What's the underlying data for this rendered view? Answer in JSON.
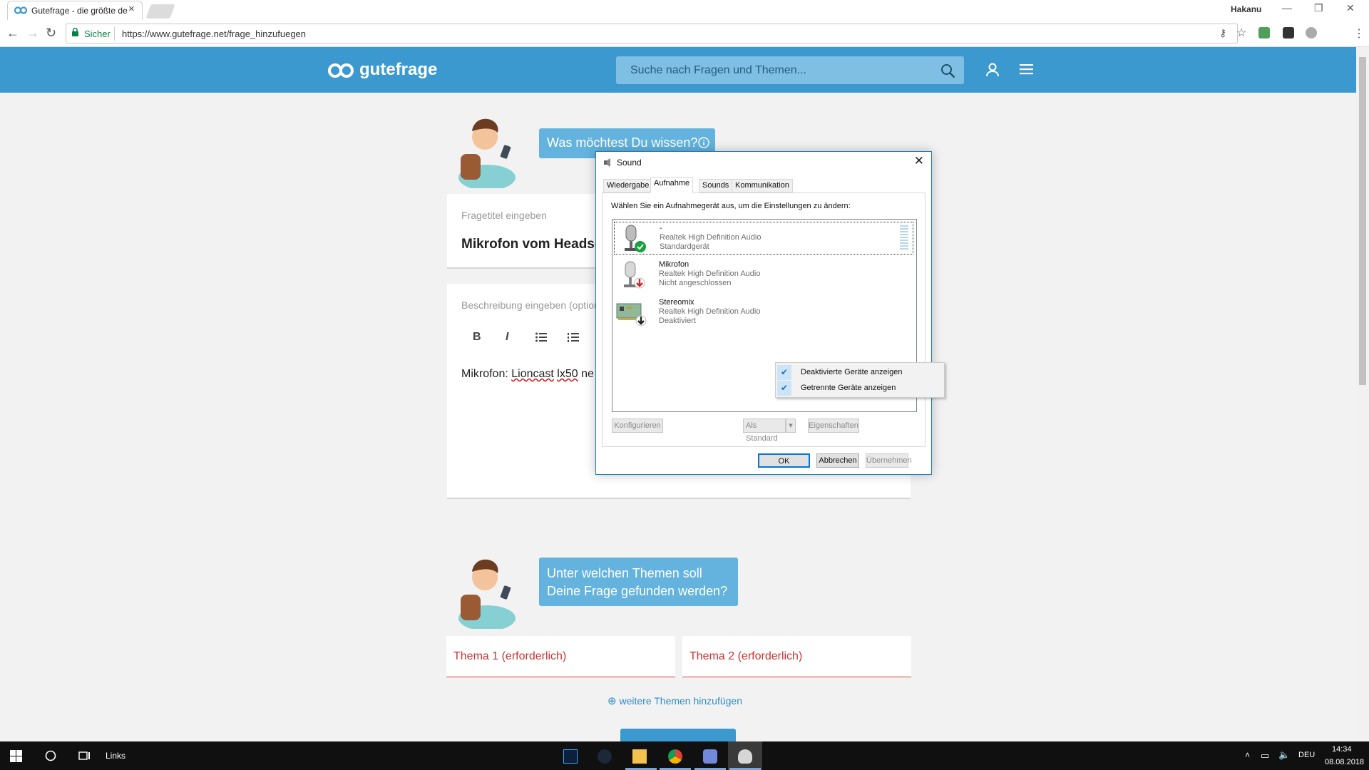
{
  "browser": {
    "tab_title": "Gutefrage - die größte de",
    "tab_close": "×",
    "user": "Hakanu",
    "secure_label": "Sicher",
    "url": "https://www.gutefrage.net/frage_hinzufuegen"
  },
  "site": {
    "logo": "gutefrage",
    "search_placeholder": "Suche nach Fragen und Themen..."
  },
  "question": {
    "bubble": "Was möchtest Du wissen?",
    "title_label": "Fragetitel eingeben",
    "title_value": "Mikrofon vom Headse",
    "desc_label": "Beschreibung eingeben (option",
    "toolbar": {
      "bold": "B",
      "italic": "I"
    },
    "desc_text_prefix": "Mikrofon: ",
    "desc_text_word1": "Lioncast",
    "desc_text_word2": "lx50",
    "desc_text_suffix": " ne"
  },
  "topics": {
    "bubble_line1": "Unter welchen Themen soll",
    "bubble_line2": "Deine Frage gefunden werden?",
    "topic1": "Thema 1 (erforderlich)",
    "topic2": "Thema 2 (erforderlich)",
    "add_more": "weitere Themen hinzufügen"
  },
  "dialog": {
    "title": "Sound",
    "tabs": [
      "Wiedergabe",
      "Aufnahme",
      "Sounds",
      "Kommunikation"
    ],
    "instruction": "Wählen Sie ein Aufnahmegerät aus, um die Einstellungen zu ändern:",
    "devices": [
      {
        "name": "-",
        "driver": "Realtek High Definition Audio",
        "status": "Standardgerät"
      },
      {
        "name": "Mikrofon",
        "driver": "Realtek High Definition Audio",
        "status": "Nicht angeschlossen"
      },
      {
        "name": "Stereomix",
        "driver": "Realtek High Definition Audio",
        "status": "Deaktiviert"
      }
    ],
    "context_menu": [
      "Deaktivierte Geräte anzeigen",
      "Getrennte Geräte anzeigen"
    ],
    "buttons": {
      "configure": "Konfigurieren",
      "set_default": "Als Standard",
      "properties": "Eigenschaften",
      "ok": "OK",
      "cancel": "Abbrechen",
      "apply": "Übernehmen"
    }
  },
  "taskbar": {
    "links": "Links",
    "lang": "DEU",
    "time": "14:34",
    "date": "08.08.2018"
  },
  "colors": {
    "brand": "#3c99cf",
    "bubble": "#63b3de",
    "required": "#cc3333"
  }
}
